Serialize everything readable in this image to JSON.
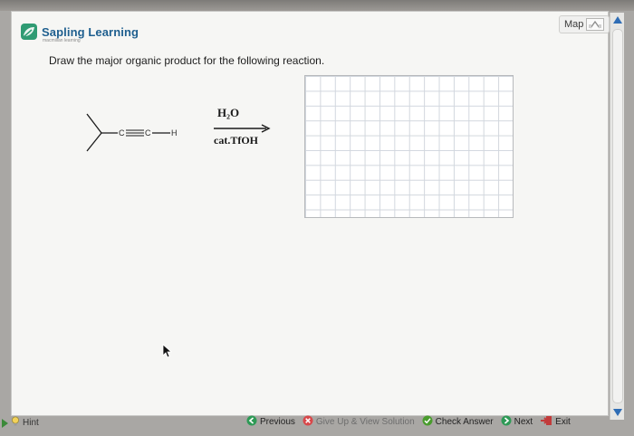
{
  "app": {
    "brand": "Sapling Learning",
    "brand_sub": "macmillan learning",
    "map_label": "Map"
  },
  "question": {
    "prompt": "Draw the major organic product for the following reaction."
  },
  "reaction": {
    "reagent_top": "H₂O",
    "reagent_bottom": "cat.TfOH",
    "alkyne_label_c1": "C",
    "alkyne_label_c2": "C",
    "alkyne_label_h": "H"
  },
  "footer": {
    "hint": "Hint",
    "previous": "Previous",
    "give_up": "Give Up & View Solution",
    "check_answer": "Check Answer",
    "next": "Next",
    "exit": "Exit"
  },
  "colors": {
    "brand_green": "#2f9b73",
    "brand_blue": "#1f5f8f",
    "scroll_arrow": "#2f6db5"
  }
}
